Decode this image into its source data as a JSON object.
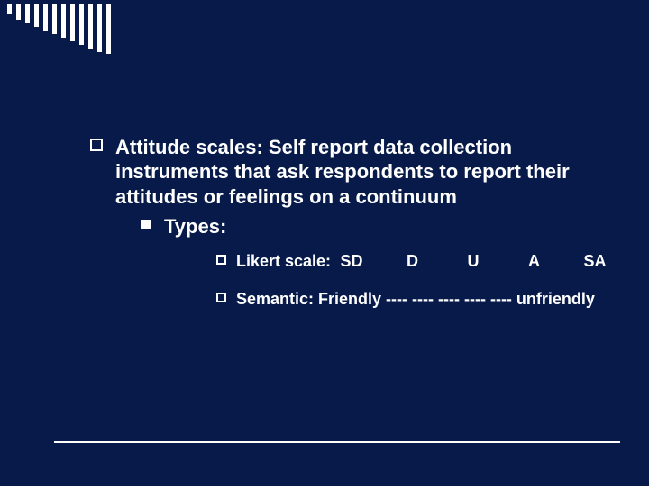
{
  "bullet": {
    "text": "Attitude scales: Self report data collection instruments that ask respondents to report their attitudes or feelings on a continuum",
    "sub": {
      "label": "Types:",
      "items": {
        "likert": {
          "label": "Likert scale:",
          "opts": [
            "SD",
            "D",
            "U",
            "A",
            "SA"
          ]
        },
        "semantic": "Semantic: Friendly ----  ----  ----  ----  ---- unfriendly"
      }
    }
  }
}
